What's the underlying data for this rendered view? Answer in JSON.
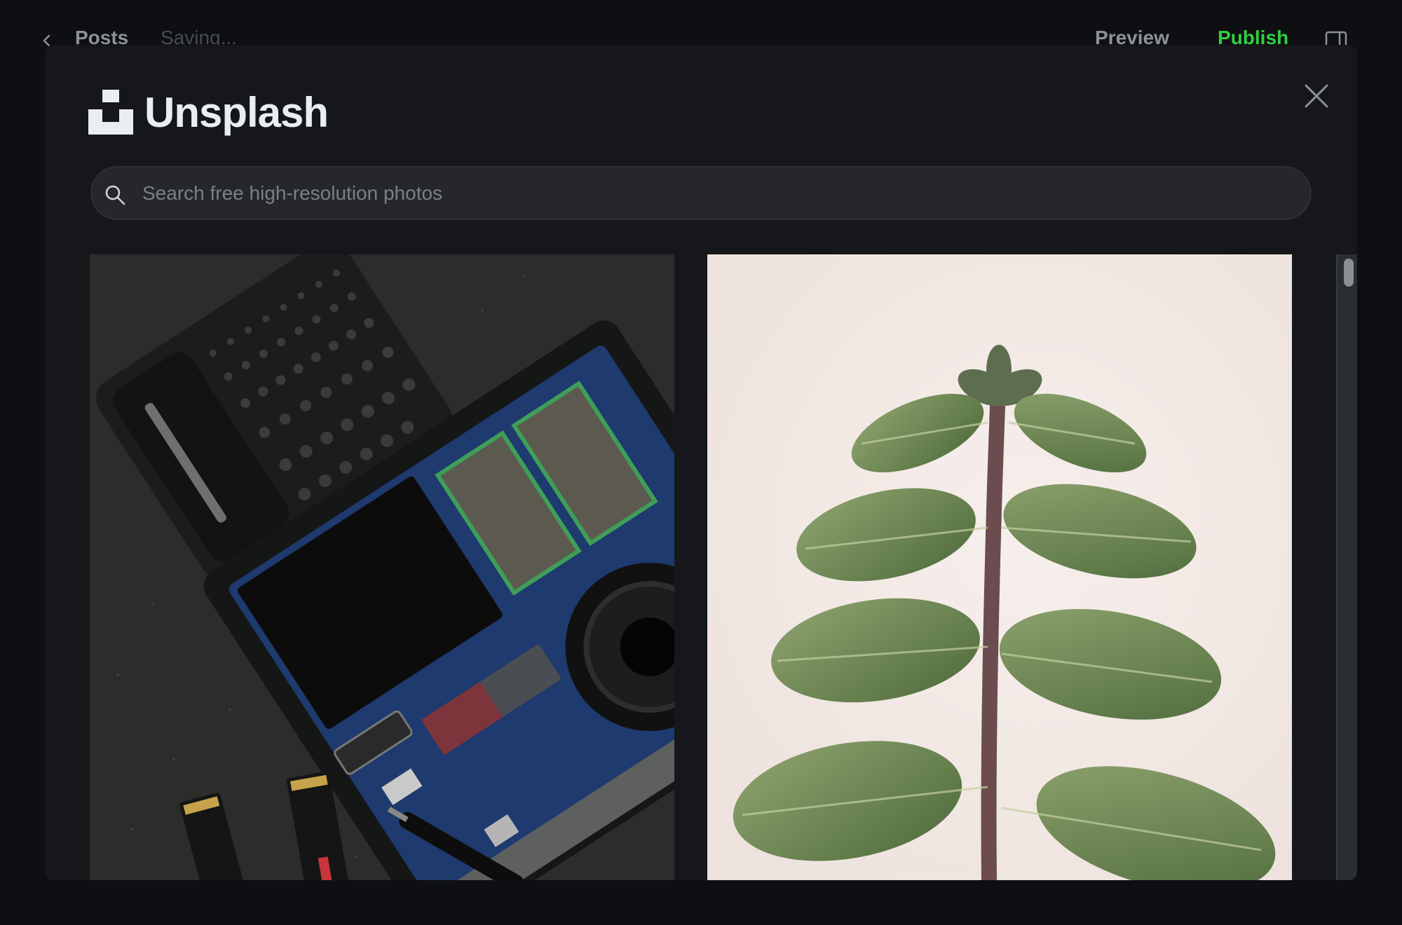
{
  "editor": {
    "back_label": "Posts",
    "save_status": "Saving...",
    "preview_label": "Preview",
    "publish_label": "Publish"
  },
  "modal": {
    "brand_name": "Unsplash",
    "search": {
      "placeholder": "Search free high-resolution photos",
      "value": ""
    },
    "photos": [
      {
        "subject": "opened laptop motherboard with tool kit and SSDs"
      },
      {
        "subject": "green mint plant on light background"
      }
    ]
  },
  "colors": {
    "background": "#0e0f12",
    "modal_bg": "#15171a",
    "search_bg": "#25272b",
    "publish_accent": "#30cf43"
  },
  "icons": [
    "chevron-left-icon",
    "sidebar-toggle-icon",
    "close-icon",
    "unsplash-logo-icon",
    "search-icon"
  ]
}
